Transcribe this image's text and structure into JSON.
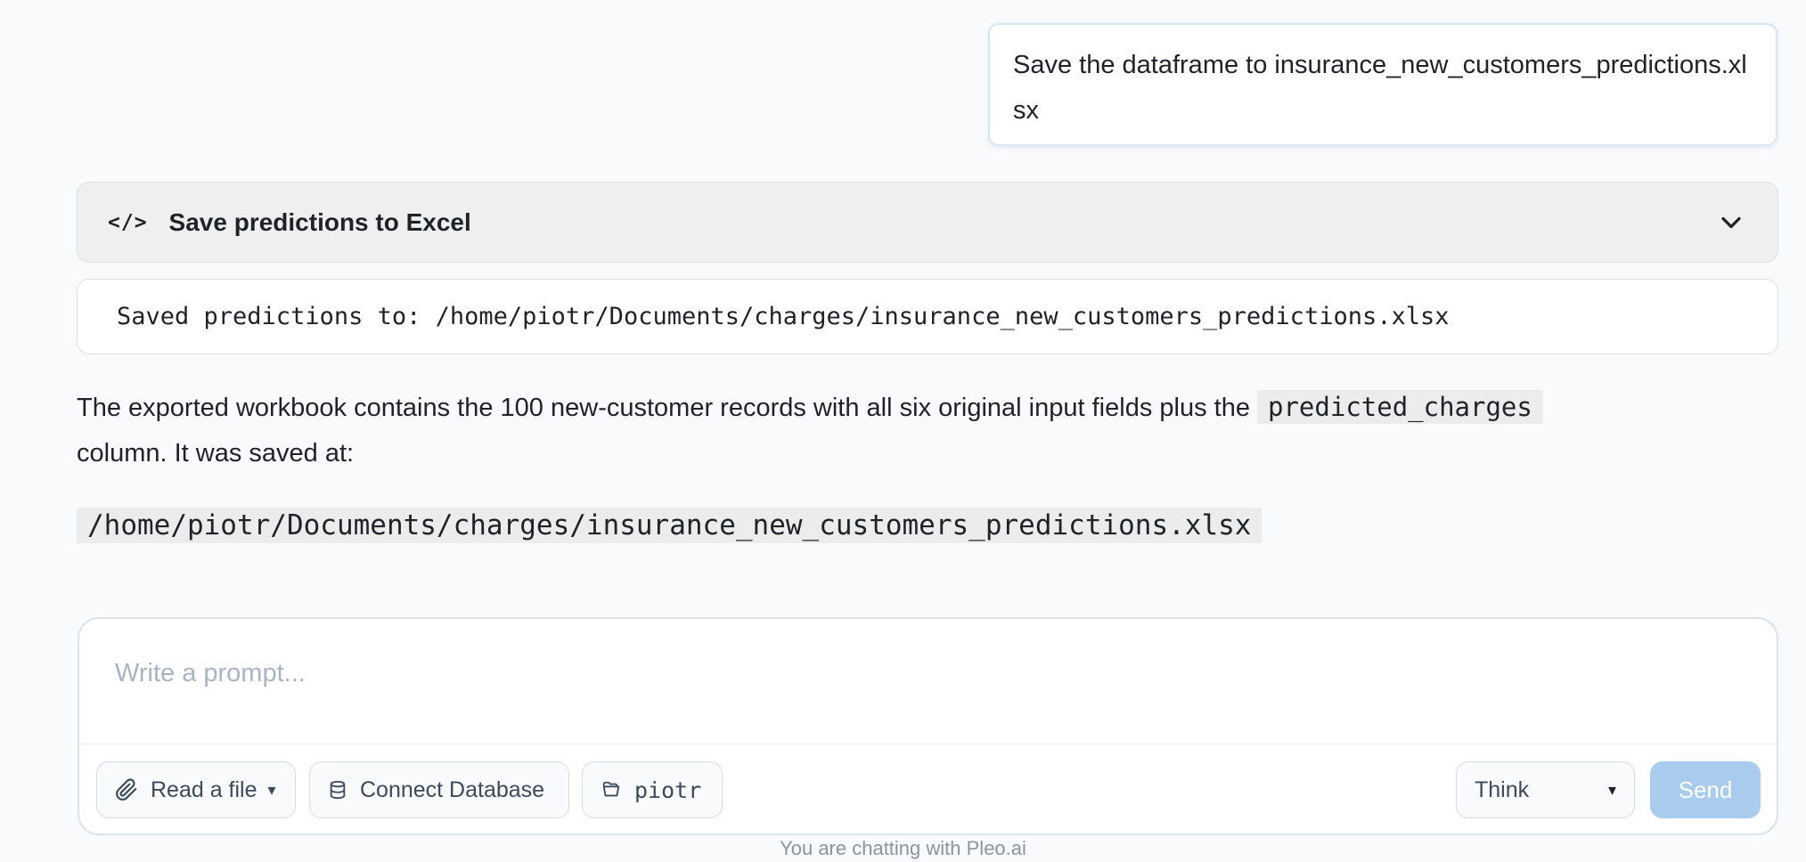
{
  "user_message": {
    "text": "Save the dataframe to insurance_new_customers_predictions.xlsx"
  },
  "tool_block": {
    "icon": "code-icon",
    "icon_glyph": "</>",
    "title": "Save predictions to Excel",
    "toggle_icon": "chevron-down-icon",
    "output": "Saved predictions to: /home/piotr/Documents/charges/insurance_new_customers_predictions.xlsx"
  },
  "answer": {
    "text_before": "The exported workbook contains the 100 new-customer records with all six original input fields plus the ",
    "inline_code": "predicted_charges",
    "text_after": " column. It was saved at:",
    "path": "/home/piotr/Documents/charges/insurance_new_customers_predictions.xlsx"
  },
  "composer": {
    "placeholder": "Write a prompt...",
    "value": "",
    "read_file_label": "Read a file",
    "read_file_icon": "paperclip-icon",
    "connect_db_label": "Connect Database",
    "connect_db_icon": "database-icon",
    "directory_label": "piotr",
    "directory_icon": "folder-open-icon",
    "mode_selected": "Think",
    "send_label": "Send"
  },
  "footer": {
    "note": "You are chatting with Pleo.ai"
  },
  "colors": {
    "page_background": "#f8fafc",
    "send_button": "#a9cbed",
    "tool_header_bg": "#efefef",
    "code_bg": "#ececec"
  }
}
